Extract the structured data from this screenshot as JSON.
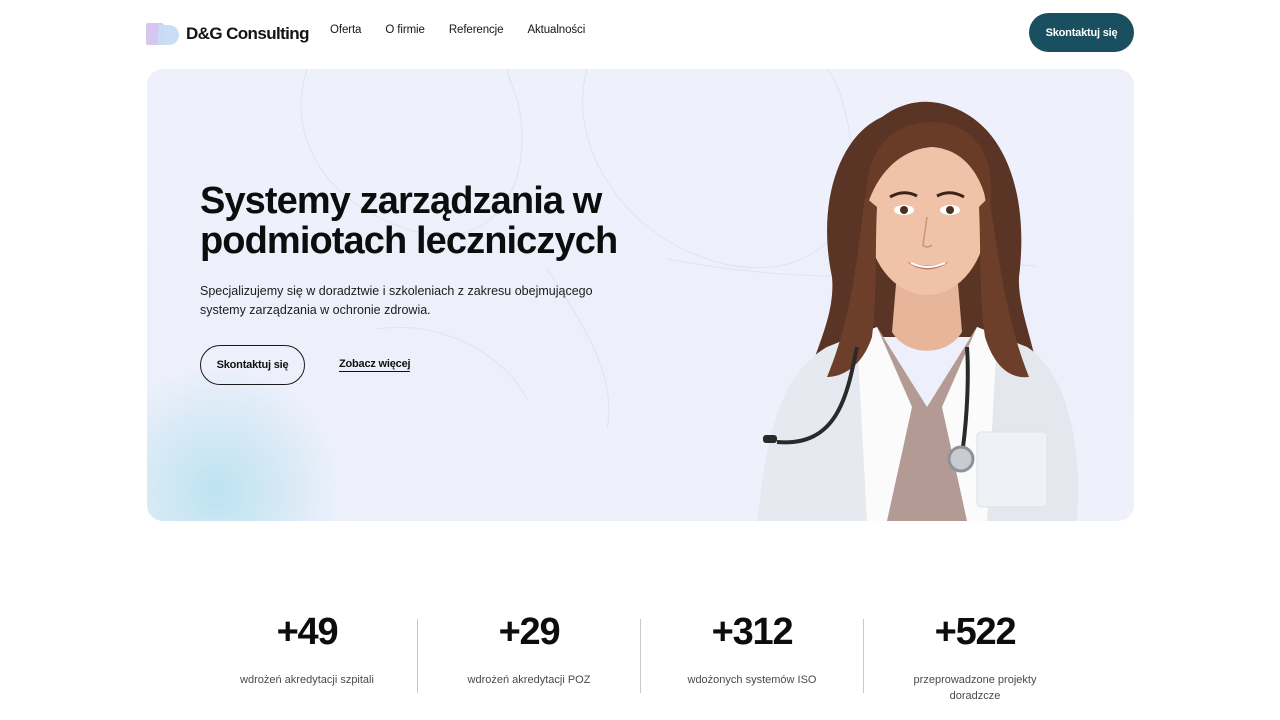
{
  "header": {
    "logo_text": "D&G Consulting",
    "nav": [
      "Oferta",
      "O firmie",
      "Referencje",
      "Aktualności"
    ],
    "cta_label": "Skontaktuj się"
  },
  "hero": {
    "title": "Systemy zarządzania w podmiotach leczniczych",
    "description": "Specjalizujemy się w doradztwie i szkoleniach z zakresu obejmującego systemy zarządzania w ochronie zdrowia.",
    "primary_button": "Skontaktuj się",
    "secondary_link": "Zobacz więcej"
  },
  "stats": [
    {
      "value": "+49",
      "label": "wdrożeń akredytacji szpitali"
    },
    {
      "value": "+29",
      "label": "wdrożeń akredytacji POZ"
    },
    {
      "value": "+312",
      "label": "wdożonych systemów ISO"
    },
    {
      "value": "+522",
      "label": "przeprowadzone projekty doradzcze"
    }
  ],
  "colors": {
    "accent": "#1a4f5f",
    "hero_bg": "#eef1fb",
    "logo_purple": "#d7c7ee",
    "logo_blue": "#c6dcf4"
  }
}
